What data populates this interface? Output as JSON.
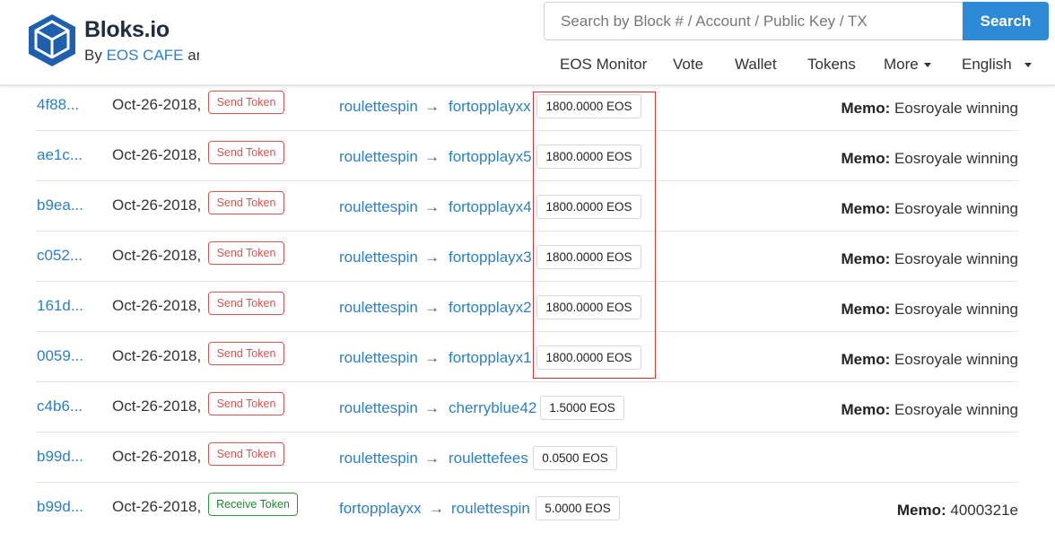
{
  "header": {
    "brand": "Bloks.io",
    "byline_prefix": "By ",
    "byline_link": "EOS CAFE",
    "byline_suffix": " and",
    "search_placeholder": "Search by Block # / Account / Public Key / TX",
    "search_button": "Search",
    "nav": [
      "EOS Monitor",
      "Vote",
      "Wallet",
      "Tokens",
      "More",
      "English"
    ],
    "colors": {
      "accent": "#2d8ad6",
      "link": "#2d7fc6",
      "logo": "#1f5fae"
    }
  },
  "rows": [
    {
      "tx": "4f88...",
      "date": "Oct-26-2018,",
      "action": "Send Token",
      "from": "roulettespin",
      "arrow": "→",
      "to": "fortopplayxx",
      "amount": "1800.0000 EOS",
      "memo_label": "Memo:",
      "memo": "Eosroyale winning"
    },
    {
      "tx": "ae1c...",
      "date": "Oct-26-2018,",
      "action": "Send Token",
      "from": "roulettespin",
      "arrow": "→",
      "to": "fortopplayx5",
      "amount": "1800.0000 EOS",
      "memo_label": "Memo:",
      "memo": "Eosroyale winning"
    },
    {
      "tx": "b9ea...",
      "date": "Oct-26-2018,",
      "action": "Send Token",
      "from": "roulettespin",
      "arrow": "→",
      "to": "fortopplayx4",
      "amount": "1800.0000 EOS",
      "memo_label": "Memo:",
      "memo": "Eosroyale winning"
    },
    {
      "tx": "c052...",
      "date": "Oct-26-2018,",
      "action": "Send Token",
      "from": "roulettespin",
      "arrow": "→",
      "to": "fortopplayx3",
      "amount": "1800.0000 EOS",
      "memo_label": "Memo:",
      "memo": "Eosroyale winning"
    },
    {
      "tx": "161d...",
      "date": "Oct-26-2018,",
      "action": "Send Token",
      "from": "roulettespin",
      "arrow": "→",
      "to": "fortopplayx2",
      "amount": "1800.0000 EOS",
      "memo_label": "Memo:",
      "memo": "Eosroyale winning"
    },
    {
      "tx": "0059...",
      "date": "Oct-26-2018,",
      "action": "Send Token",
      "from": "roulettespin",
      "arrow": "→",
      "to": "fortopplayx1",
      "amount": "1800.0000 EOS",
      "memo_label": "Memo:",
      "memo": "Eosroyale winning"
    },
    {
      "tx": "c4b6...",
      "date": "Oct-26-2018,",
      "action": "Send Token",
      "from": "roulettespin",
      "arrow": "→",
      "to": "cherryblue42",
      "amount": "1.5000 EOS",
      "memo_label": "Memo:",
      "memo": "Eosroyale winning"
    },
    {
      "tx": "b99d...",
      "date": "Oct-26-2018,",
      "action": "Send Token",
      "from": "roulettespin",
      "arrow": "→",
      "to": "roulettefees",
      "amount": "0.0500 EOS"
    },
    {
      "tx": "b99d...",
      "date": "Oct-26-2018,",
      "action": "Receive Token",
      "from": "fortopplayxx",
      "arrow": "→",
      "to": "roulettespin",
      "amount": "5.0000 EOS",
      "memo_label": "Memo:",
      "memo": "4000321e"
    }
  ]
}
